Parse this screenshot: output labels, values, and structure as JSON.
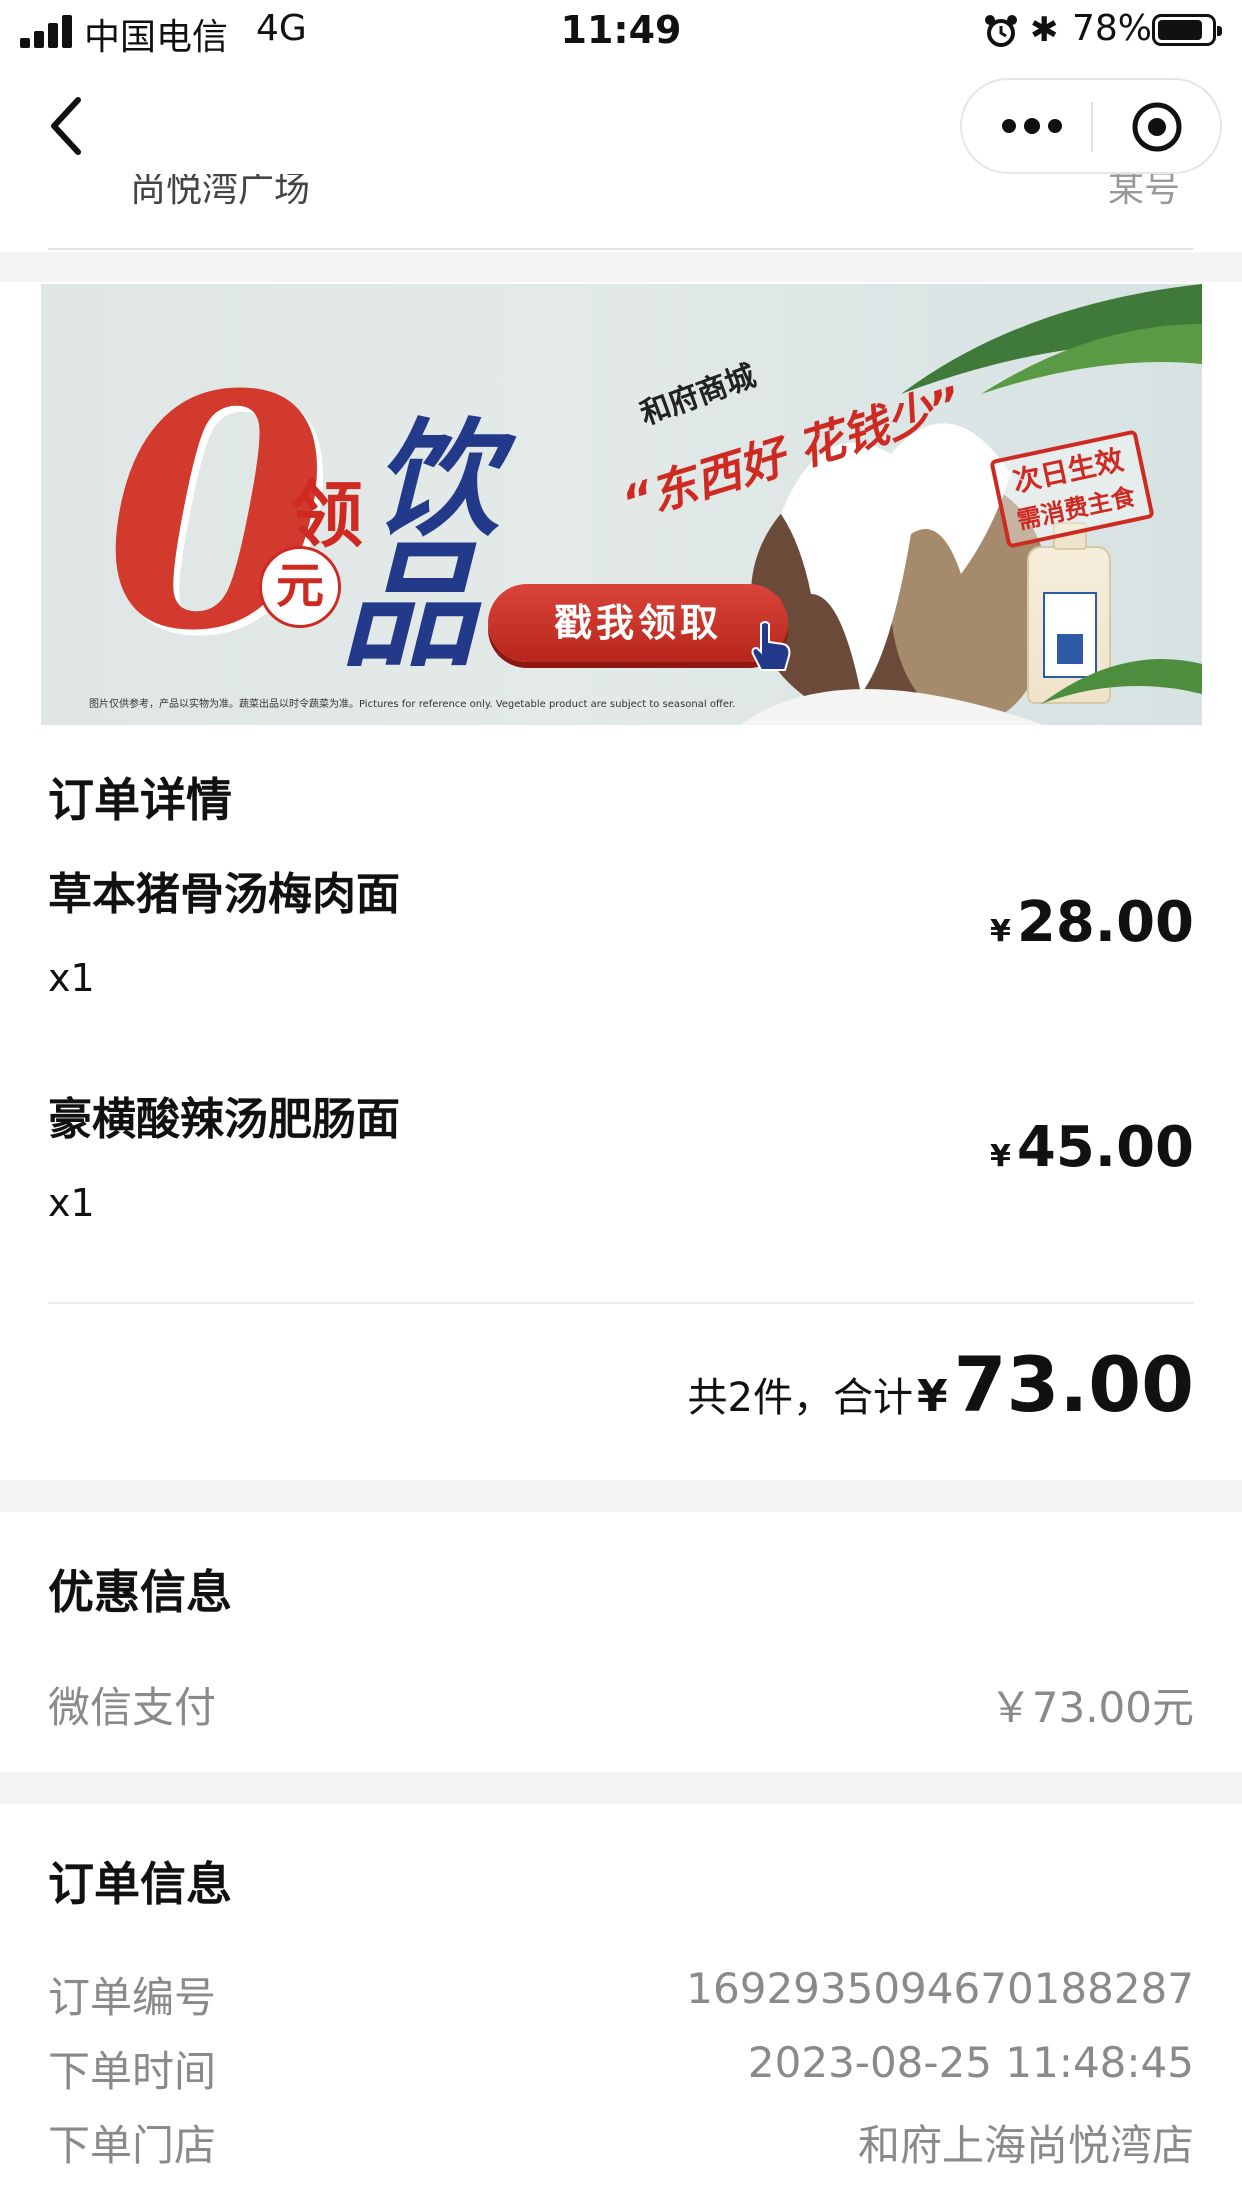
{
  "status_bar": {
    "carrier": "中国电信",
    "network": "4G",
    "time": "11:49",
    "battery": "78%"
  },
  "partial_header": {
    "left": "尚悦湾广场",
    "right": "某号"
  },
  "banner": {
    "big_zero": "0",
    "ling": "领",
    "yuan": "元",
    "yin": "饮",
    "pin": "品",
    "mall": "和府商城",
    "slogan": "“东西好 花钱少”",
    "cta": "戳我领取",
    "stamp_line1": "次日生效",
    "stamp_line2": "需消费主食",
    "disclaimer": "图片仅供参考，产品以实物为准。蔬菜出品以时令蔬菜为准。Pictures for reference only. Vegetable product are subject to seasonal offer."
  },
  "order_details": {
    "title": "订单详情",
    "items": [
      {
        "name": "草本猪骨汤梅肉面",
        "qty": "x1",
        "currency": "¥",
        "price": "28.00"
      },
      {
        "name": "豪横酸辣汤肥肠面",
        "qty": "x1",
        "currency": "¥",
        "price": "45.00"
      }
    ],
    "total_label": "共2件，合计",
    "total_currency": "¥",
    "total": "73.00"
  },
  "discount": {
    "title": "优惠信息",
    "label": "微信支付",
    "value": "￥73.00元"
  },
  "order_info": {
    "title": "订单信息",
    "rows": [
      {
        "label": "订单编号",
        "value": "1692935094670188287"
      },
      {
        "label": "下单时间",
        "value": "2023-08-25 11:48:45"
      },
      {
        "label": "下单门店",
        "value": "和府上海尚悦湾店"
      }
    ]
  }
}
